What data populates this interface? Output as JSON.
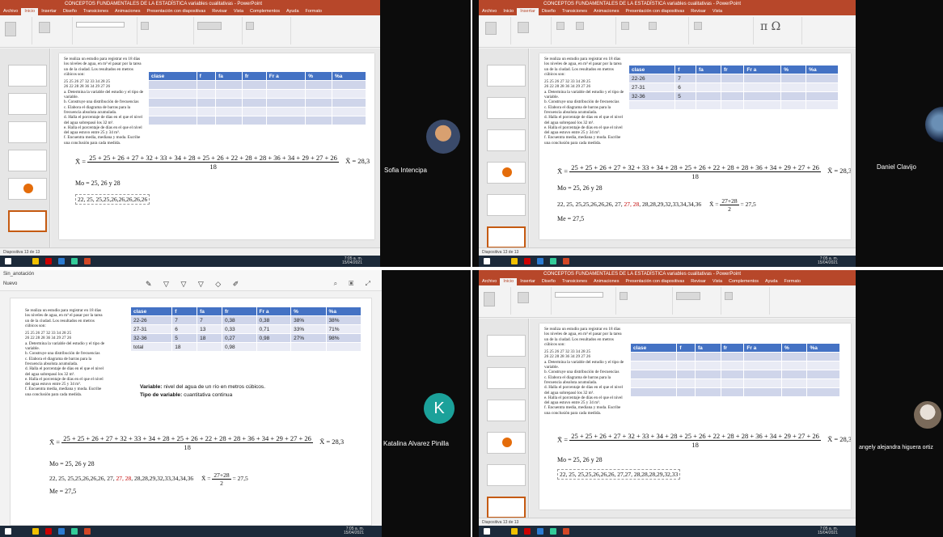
{
  "ppt": {
    "title": "CONCEPTOS FUNDAMENTALES DE LA ESTADÍSTICA variables cualitativas - PowerPoint",
    "tabs": [
      "Archivo",
      "Inicio",
      "Insertar",
      "Diseño",
      "Transiciones",
      "Animaciones",
      "Presentación con diapositivas",
      "Revisar",
      "Vista",
      "Complementos",
      "Ayuda",
      "Formato"
    ],
    "search": "¿Qué desea hacer?",
    "share": "Compartir",
    "status_left": "Diapositiva 13 de 13",
    "notes": "Notas",
    "comments": "Comentarios"
  },
  "problem": {
    "intro": "Se realiza un estudio para registrar en 18 días los niveles de agua, en m³ el pasar por la tarea un de la ciudad. Los resultados en metros cúbicos son:",
    "row1": "25   25   26   27   32   33   34   28   25",
    "row2": "26   22   28   28   36   34   29   27   26",
    "items": [
      "a.  Determina la variable del estudio y el tipo de variable.",
      "b.  Construye una distribución de frecuencias",
      "c.  Elabora el diagrama de barras para la frecuencia absoluta acumulada.",
      "d.  Halla el porcentaje de días en el que el nivel del agua sobrepasó los 32 m³.",
      "e.  Halla el porcentaje de días en el que el nivel del agua estuvo entre 25 y 34 m³.",
      "f.  Encuentra media, mediana y moda. Escribe una conclusión para cada medida."
    ]
  },
  "table": {
    "headers": [
      "clase",
      "f",
      "fa",
      "fr",
      "Fr a",
      "%",
      "%a"
    ],
    "tile2_rows": [
      [
        "22-26",
        "7"
      ],
      [
        "27-31",
        "6"
      ],
      [
        "32-36",
        "5"
      ]
    ],
    "tile3_rows": [
      [
        "22-26",
        "7",
        "7",
        "0,38",
        "0,38",
        "38%",
        "38%"
      ],
      [
        "27-31",
        "6",
        "13",
        "0,33",
        "0,71",
        "33%",
        "71%"
      ],
      [
        "32-36",
        "5",
        "18",
        "0,27",
        "0,98",
        "27%",
        "98%"
      ],
      [
        "total",
        "18",
        "",
        "0,98",
        "",
        "",
        ""
      ]
    ]
  },
  "formulas": {
    "mean_lhs": "X̄ =",
    "mean_num": "25 + 25 + 26 + 27 + 32 + 33 + 34 + 28 + 25 + 26 + 22 + 28 + 28 + 36 + 34 + 29 + 27 + 26",
    "mean_den": "18",
    "mean_rhs": "X̄ = 28,3",
    "mode": "Mo = 25, 26 y 28",
    "sorted_short": "22, 25, 25,25,26,26,26,26,26",
    "sorted_start": "22, 25, 25,25,26,26,26, 27, ",
    "sorted_red": "27, 28",
    "sorted_end": ", 28,28,29,32,33,34,34,36",
    "sorted_t4": "22, 25, 25,25,26,26,26, 27,27, 28,28,28,29,32,33",
    "median_lhs": "X̄ =",
    "median_num": "27+28",
    "median_den": "2",
    "median_rhs": "= 27,5",
    "median": "Me = 27,5"
  },
  "annotations": {
    "variable_label": "Variable:",
    "variable_text": " nivel del agua de un río en metros cúbicos.",
    "type_label": "Tipo de variable:",
    "type_text": " cuantitativa continua"
  },
  "participants": {
    "p1": "Sofia Intencipa",
    "p2": "Daniel Clavijo",
    "p3": "Katalina Alvarez Pinilla",
    "p3_initial": "K",
    "p4": "angely alejandra higuera ortiz"
  },
  "pdf": {
    "title": "Sin_anotación",
    "sub": "Nuevo"
  },
  "taskbar": {
    "time": "7:05 a. m.",
    "date": "15/04/2021"
  }
}
